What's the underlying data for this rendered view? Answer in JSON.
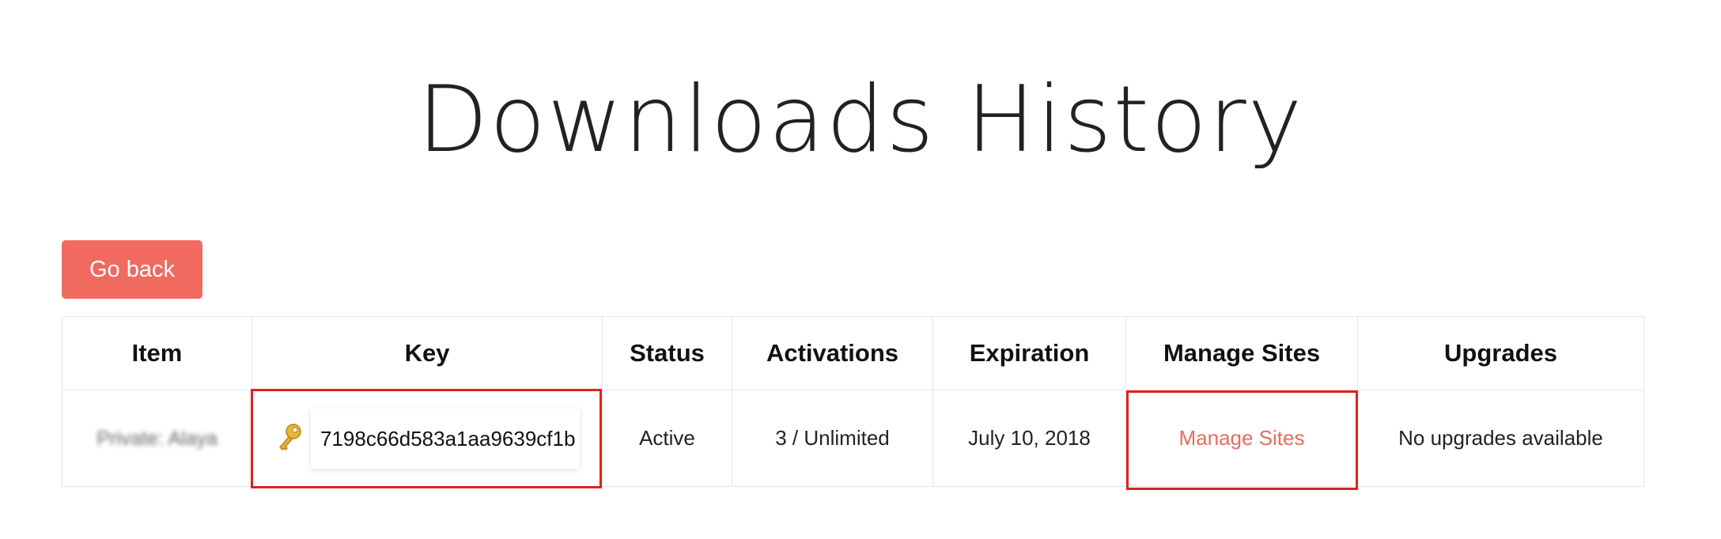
{
  "page": {
    "title": "Downloads History"
  },
  "actions": {
    "go_back_label": "Go back"
  },
  "table": {
    "headers": {
      "item": "Item",
      "key": "Key",
      "status": "Status",
      "activations": "Activations",
      "expiration": "Expiration",
      "manage_sites": "Manage Sites",
      "upgrades": "Upgrades"
    },
    "rows": [
      {
        "item": "Private: Alaya",
        "key_icon": "key-icon",
        "key": "7198c66d583a1aa9639cf1b",
        "status": "Active",
        "activations": "3 / Unlimited",
        "expiration": "July 10, 2018",
        "manage_sites": "Manage Sites",
        "upgrades": "No upgrades available"
      }
    ]
  },
  "colors": {
    "accent": "#f06a60",
    "highlight": "#e02020",
    "border": "#e6e6e6",
    "key_icon": "#e8b43a"
  }
}
